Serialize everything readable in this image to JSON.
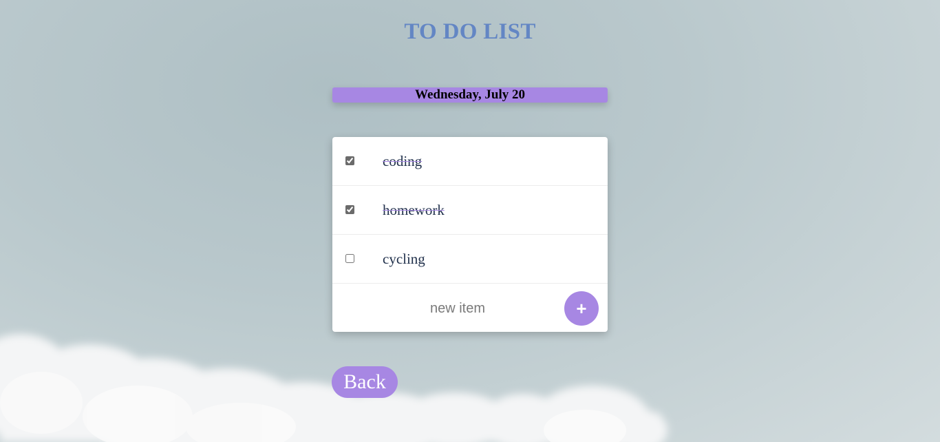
{
  "header": {
    "title": "TO DO LIST"
  },
  "date_banner": {
    "text": "Wednesday, July 20"
  },
  "todo": {
    "items": [
      {
        "label": "coding",
        "checked": true
      },
      {
        "label": "homework",
        "checked": true
      },
      {
        "label": "cycling",
        "checked": false
      }
    ],
    "new_item": {
      "placeholder": "new item",
      "value": ""
    },
    "add_button_label": "+"
  },
  "footer": {
    "back_label": "Back"
  },
  "colors": {
    "title": "#6386c4",
    "accent": "#a787e3",
    "item_text": "#1f2f4a",
    "card_background": "#ffffff"
  },
  "icons": {
    "add": "plus-icon",
    "check": "checkbox"
  }
}
